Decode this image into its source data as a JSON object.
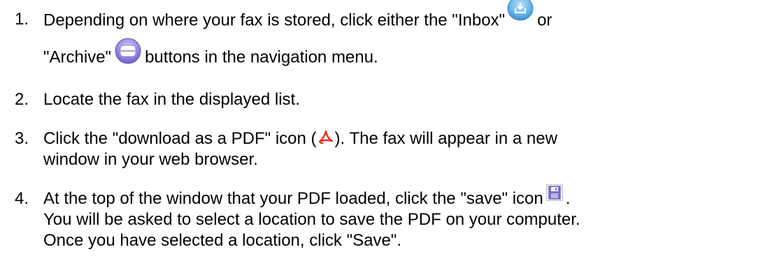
{
  "steps": [
    {
      "number": "1.",
      "line1_a": "Depending on where your fax is stored, click either the \"Inbox\"",
      "line1_b": "or",
      "line2_a": "\"Archive\"",
      "line2_b": "buttons in the navigation menu.",
      "icons": [
        "inbox-icon",
        "archive-icon"
      ]
    },
    {
      "number": "2.",
      "line1": "Locate the fax in the displayed list."
    },
    {
      "number": "3.",
      "line1_a": "Click the \"download as a PDF\" icon (",
      "line1_b": "). The fax will appear in a new",
      "line2": "window in your web browser.",
      "icons": [
        "pdf-icon"
      ]
    },
    {
      "number": "4.",
      "line1_a": "At the top of the window that your PDF loaded, click the \"save\" icon",
      "line1_b": ".",
      "line2": "You will be asked to select a location to save the PDF on your computer.",
      "line3": "Once you have selected a location, click \"Save\".",
      "icons": [
        "save-icon"
      ]
    }
  ],
  "colors": {
    "inbox_blue": "#5aaae6",
    "archive_purple": "#8e7fd6",
    "pdf_red": "#e8341c",
    "save_purple": "#7a72c9"
  }
}
